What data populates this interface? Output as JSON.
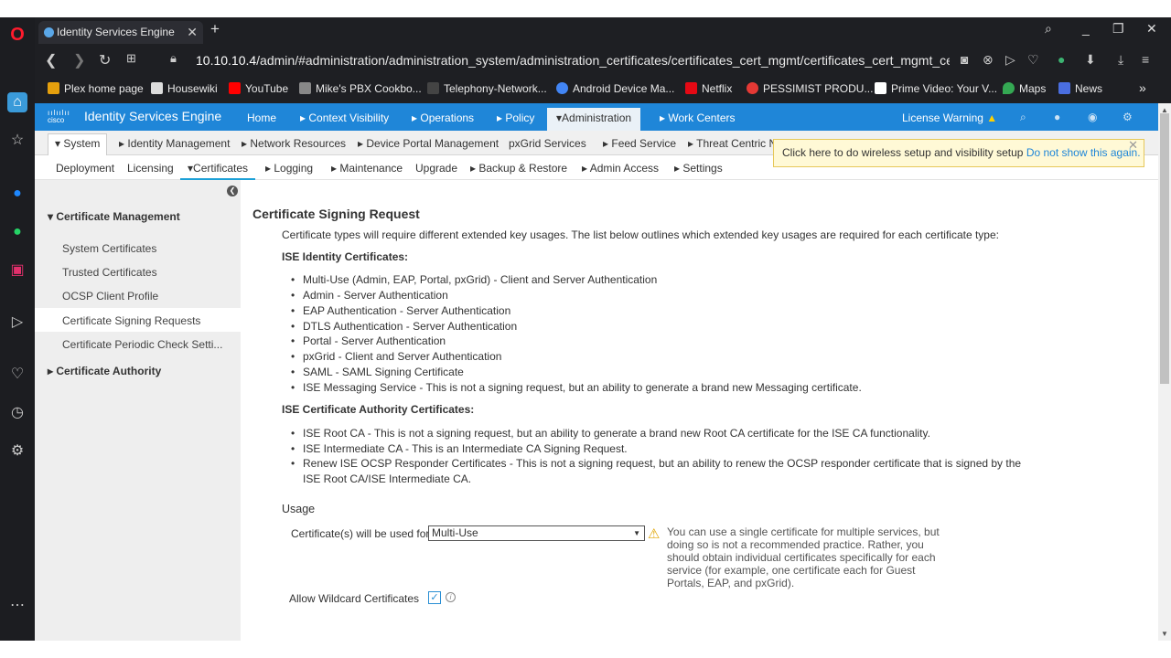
{
  "browser": {
    "tab_title": "Identity Services Engine",
    "url_host": "10.10.10.4",
    "url_path": "/admin/#administration/administration_system/administration_certificates/certificates_cert_mgmt/certificates_cert_mgmt_cer",
    "bookmarks": [
      {
        "label": "Plex home page",
        "icon": "plex-icon",
        "color": "#e5a00d"
      },
      {
        "label": "Housewiki",
        "icon": "page-icon",
        "color": "#dddddd"
      },
      {
        "label": "YouTube",
        "icon": "youtube-icon",
        "color": "#ff0000"
      },
      {
        "label": "Mike's PBX Cookbo...",
        "icon": "pbx-icon",
        "color": "#888888"
      },
      {
        "label": "Telephony-Network...",
        "icon": "heart-icon",
        "color": "#444444"
      },
      {
        "label": "Android Device Ma...",
        "icon": "google-icon",
        "color": "#4285f4"
      },
      {
        "label": "Netflix",
        "icon": "netflix-icon",
        "color": "#e50914"
      },
      {
        "label": "PESSIMIST PRODU...",
        "icon": "pessimist-icon",
        "color": "#e53935"
      },
      {
        "label": "Prime Video: Your V...",
        "icon": "amazon-icon",
        "color": "#ffffff"
      },
      {
        "label": "Maps",
        "icon": "maps-icon",
        "color": "#34a853"
      },
      {
        "label": "News",
        "icon": "news-icon",
        "color": "#4a6ee0"
      }
    ],
    "more_bookmarks": "»"
  },
  "ise": {
    "brand": "Identity Services Engine",
    "cisco": "cisco",
    "menu": {
      "home": "Home",
      "context": "▸ Context Visibility",
      "operations": "▸ Operations",
      "policy": "▸ Policy",
      "administration": "▾Administration",
      "workcenters": "▸ Work Centers"
    },
    "license_warning": "License Warning",
    "system_nav": {
      "system": "▾ System",
      "identity": "▸ Identity Management",
      "network": "▸ Network Resources",
      "device_portal": "▸ Device Portal Management",
      "pxgrid": "pxGrid Services",
      "feed": "▸ Feed Service",
      "threat": "▸ Threat Centric N"
    },
    "sub_nav": {
      "deployment": "Deployment",
      "licensing": "Licensing",
      "certificates": "▾Certificates",
      "logging": "▸ Logging",
      "maintenance": "▸ Maintenance",
      "upgrade": "Upgrade",
      "backup": "▸ Backup & Restore",
      "admin_access": "▸ Admin Access",
      "settings": "▸ Settings"
    },
    "sidebar": {
      "cert_mgmt": "▾ Certificate Management",
      "items": [
        "System Certificates",
        "Trusted Certificates",
        "OCSP Client Profile",
        "Certificate Signing Requests",
        "Certificate Periodic Check Setti..."
      ],
      "cert_authority": "▸ Certificate Authority"
    },
    "popup": {
      "text": "Click here to do wireless setup and visibility setup",
      "link": "Do not show this again.",
      "close": "✕"
    }
  },
  "content": {
    "title": "Certificate Signing Request",
    "intro": "Certificate types will require different extended key usages. The list below outlines which extended key usages are required for each certificate type:",
    "identity_heading": "ISE Identity Certificates:",
    "identity_items": [
      "Multi-Use (Admin, EAP, Portal, pxGrid) - Client and Server Authentication",
      "Admin - Server Authentication",
      "EAP Authentication - Server Authentication",
      "DTLS Authentication - Server Authentication",
      "Portal - Server Authentication",
      "pxGrid - Client and Server Authentication",
      "SAML - SAML Signing Certificate",
      "ISE Messaging Service - This is not a signing request, but an ability to generate a brand new Messaging certificate."
    ],
    "ca_heading": "ISE Certificate Authority Certificates:",
    "ca_items": [
      "ISE Root CA - This is not a signing request, but an ability to generate a brand new Root CA certificate for the ISE CA functionality.",
      "ISE Intermediate CA - This is an Intermediate CA Signing Request.",
      "Renew ISE OCSP Responder Certificates - This is not a signing request, but an ability to renew the OCSP responder certificate that is signed by the",
      "ISE Root CA/ISE Intermediate CA."
    ],
    "usage_heading": "Usage",
    "usage_label": "Certificate(s) will be used for",
    "usage_value": "Multi-Use",
    "warning": "You can use a single certificate for multiple services, but doing so is not a recommended practice. Rather, you should obtain individual certificates specifically for each service (for example, one certificate each for Guest Portals, EAP, and pxGrid).",
    "wildcard_label": "Allow Wildcard Certificates",
    "wildcard_checked": true
  }
}
